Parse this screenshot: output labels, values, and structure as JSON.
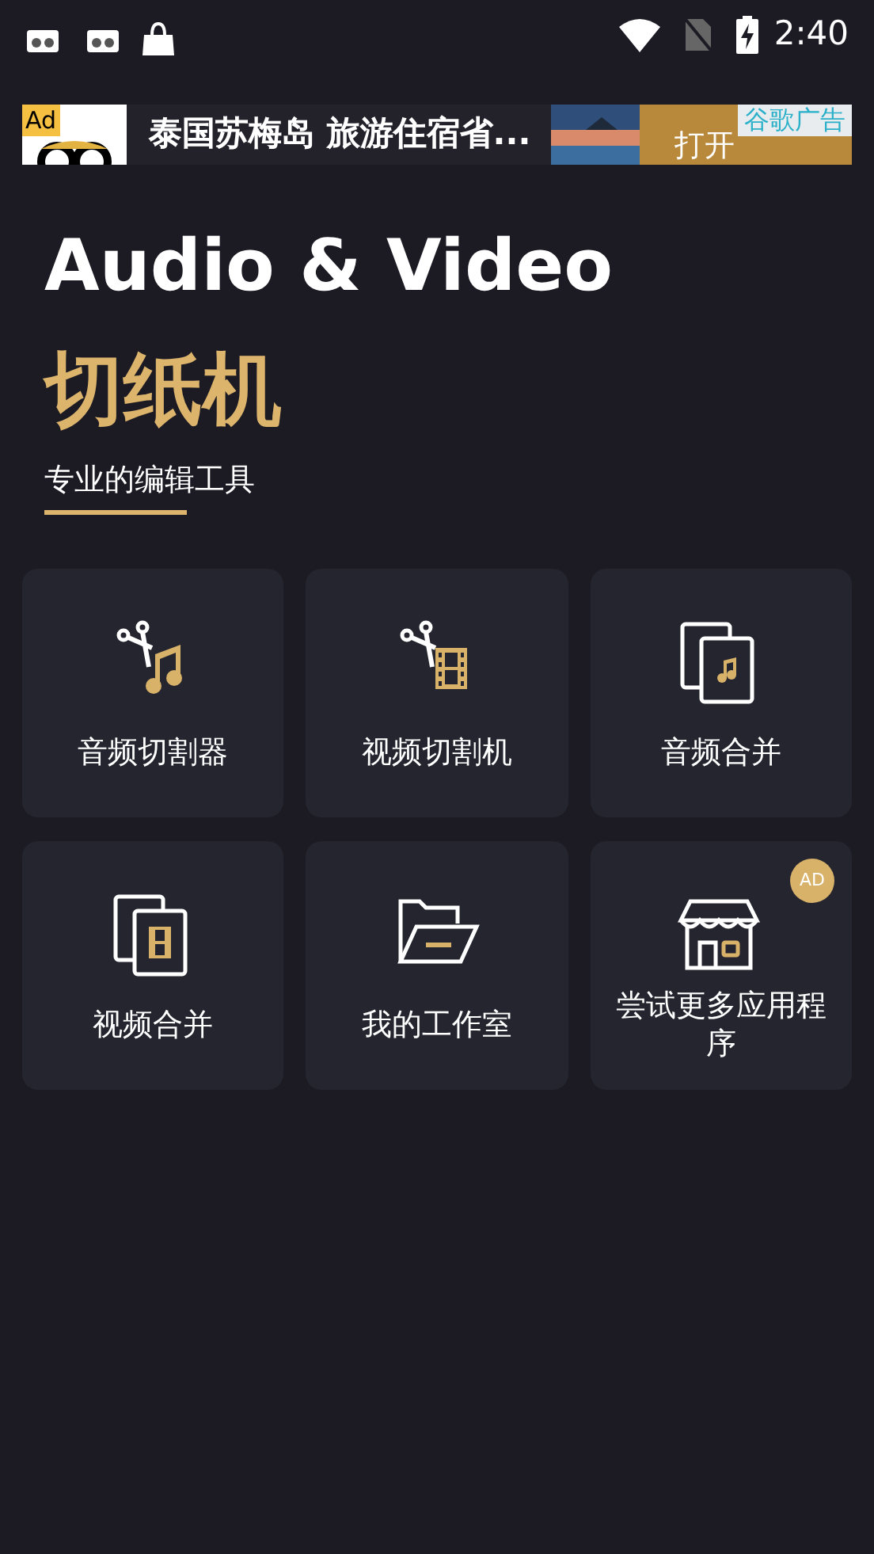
{
  "status_bar": {
    "time": "2:40"
  },
  "ad_banner": {
    "tag": "Ad",
    "headline": "泰国苏梅岛 旅游住宿省...",
    "button": "打开",
    "label": "谷歌广告"
  },
  "header": {
    "title": "Audio & Video",
    "app_name": "切纸机",
    "subtitle": "专业的编辑工具"
  },
  "tools": [
    {
      "kind": "audio-cut",
      "label": "音频切割器"
    },
    {
      "kind": "video-cut",
      "label": "视频切割机"
    },
    {
      "kind": "audio-merge",
      "label": "音频合并"
    },
    {
      "kind": "video-merge",
      "label": "视频合并"
    },
    {
      "kind": "folder",
      "label": "我的工作室"
    },
    {
      "kind": "store",
      "label": "尝试更多应用程序",
      "badge": "AD"
    }
  ]
}
